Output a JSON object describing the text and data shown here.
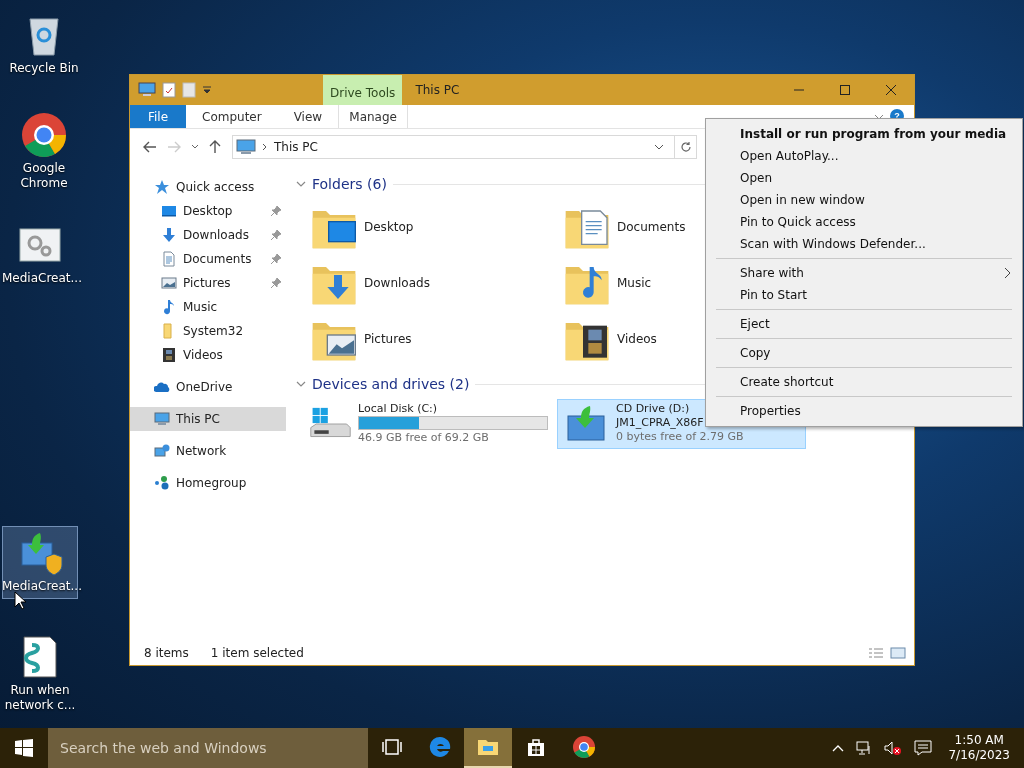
{
  "desktop_icons": [
    {
      "label": "Recycle Bin",
      "kind": "recycle",
      "selected": false
    },
    {
      "label": "Google Chrome",
      "kind": "chrome",
      "selected": false
    },
    {
      "label": "MediaCreat...",
      "kind": "gears",
      "selected": false
    },
    {
      "label": "MediaCreat...",
      "kind": "installer",
      "selected": true
    },
    {
      "label": "Run when network c...",
      "kind": "script",
      "selected": false
    }
  ],
  "window": {
    "title": "This PC",
    "context_tab": "Drive Tools",
    "help": "?",
    "ribbon_tabs": [
      {
        "label": "File",
        "kind": "file"
      },
      {
        "label": "Computer",
        "kind": "tab"
      },
      {
        "label": "View",
        "kind": "tab"
      },
      {
        "label": "Manage",
        "kind": "context"
      }
    ],
    "address": "This PC",
    "nav_pane": [
      {
        "label": "Quick access",
        "kind": "star",
        "selected": false,
        "pinned": false,
        "children": [
          {
            "label": "Desktop",
            "kind": "desktop",
            "selected": false,
            "pinned": true
          },
          {
            "label": "Downloads",
            "kind": "downloads",
            "selected": false,
            "pinned": true
          },
          {
            "label": "Documents",
            "kind": "documents",
            "selected": false,
            "pinned": true
          },
          {
            "label": "Pictures",
            "kind": "pictures",
            "selected": false,
            "pinned": true
          },
          {
            "label": "Music",
            "kind": "music",
            "selected": false,
            "pinned": false
          },
          {
            "label": "System32",
            "kind": "folder",
            "selected": false,
            "pinned": false
          },
          {
            "label": "Videos",
            "kind": "videos",
            "selected": false,
            "pinned": false
          }
        ]
      },
      {
        "label": "OneDrive",
        "kind": "cloud",
        "selected": false,
        "pinned": false
      },
      {
        "label": "This PC",
        "kind": "pc",
        "selected": true,
        "pinned": false
      },
      {
        "label": "Network",
        "kind": "network",
        "selected": false,
        "pinned": false
      },
      {
        "label": "Homegroup",
        "kind": "homegroup",
        "selected": false,
        "pinned": false
      }
    ],
    "folders": {
      "heading": "Folders (6)",
      "expanded": true,
      "items": [
        {
          "label": "Desktop",
          "kind": "desktop"
        },
        {
          "label": "Documents",
          "kind": "documents"
        },
        {
          "label": "Downloads",
          "kind": "downloads"
        },
        {
          "label": "Music",
          "kind": "music"
        },
        {
          "label": "Pictures",
          "kind": "pictures"
        },
        {
          "label": "Videos",
          "kind": "videos"
        }
      ]
    },
    "drives": {
      "heading": "Devices and drives (2)",
      "expanded": true,
      "items": [
        {
          "name": "Local Disk (C:)",
          "kind": "disk",
          "level": 0.32,
          "free": "46.9 GB free of 69.2 GB",
          "selected": false
        },
        {
          "name": "CD Drive (D:)",
          "kind": "cd",
          "volume": "JM1_CPRA_X86F",
          "free": "0 bytes free of 2.79 GB",
          "selected": true
        }
      ]
    },
    "status_bar": {
      "item_count": "8 items",
      "selection": "1 item selected"
    }
  },
  "context_menu": {
    "groups": [
      [
        {
          "label": "Install or run program from your media",
          "default": true,
          "submenu": false
        },
        {
          "label": "Open AutoPlay...",
          "default": false,
          "submenu": false
        },
        {
          "label": "Open",
          "default": false,
          "submenu": false
        },
        {
          "label": "Open in new window",
          "default": false,
          "submenu": false
        },
        {
          "label": "Pin to Quick access",
          "default": false,
          "submenu": false
        },
        {
          "label": "Scan with Windows Defender...",
          "default": false,
          "submenu": false
        }
      ],
      [
        {
          "label": "Share with",
          "default": false,
          "submenu": true
        },
        {
          "label": "Pin to Start",
          "default": false,
          "submenu": false
        }
      ],
      [
        {
          "label": "Eject",
          "default": false,
          "submenu": false
        }
      ],
      [
        {
          "label": "Copy",
          "default": false,
          "submenu": false
        }
      ],
      [
        {
          "label": "Create shortcut",
          "default": false,
          "submenu": false
        }
      ],
      [
        {
          "label": "Properties",
          "default": false,
          "submenu": false
        }
      ]
    ]
  },
  "taskbar": {
    "search_placeholder": "Search the web and Windows",
    "apps": [
      {
        "kind": "taskview",
        "active": false
      },
      {
        "kind": "edge",
        "active": false
      },
      {
        "kind": "explorer",
        "active": true
      },
      {
        "kind": "store",
        "active": false
      },
      {
        "kind": "chrome",
        "active": false
      }
    ],
    "clock": {
      "time": "1:50 AM",
      "date": "7/16/2023"
    }
  }
}
